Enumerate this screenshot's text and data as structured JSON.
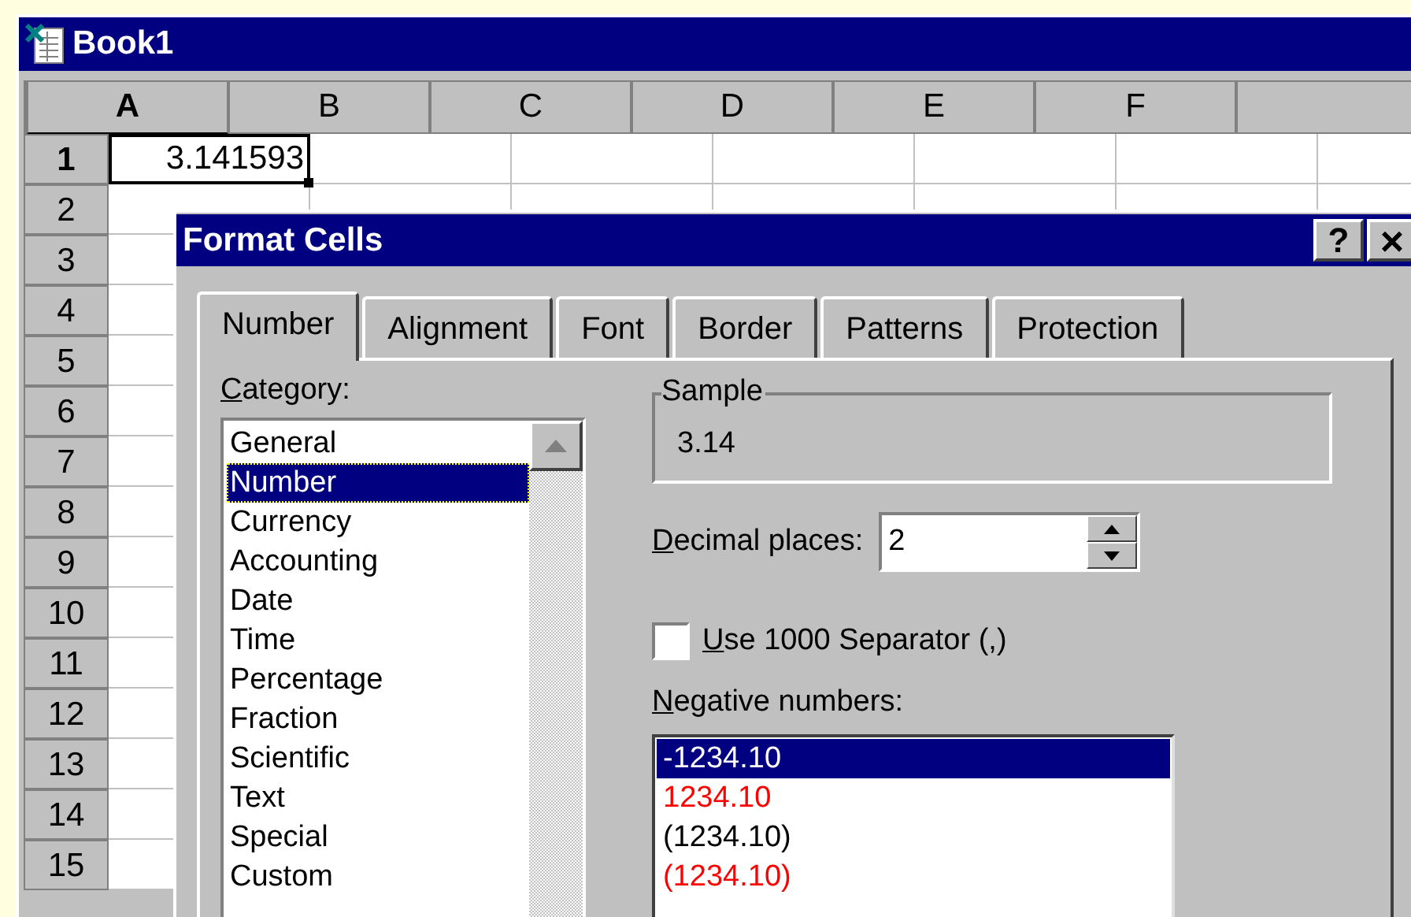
{
  "window": {
    "title": "Book1"
  },
  "sheet": {
    "columns": [
      {
        "label": "A",
        "selected": true
      },
      {
        "label": "B",
        "selected": false
      },
      {
        "label": "C",
        "selected": false
      },
      {
        "label": "D",
        "selected": false
      },
      {
        "label": "E",
        "selected": false
      },
      {
        "label": "F",
        "selected": false
      }
    ],
    "rows": [
      {
        "label": "1",
        "selected": true
      },
      {
        "label": "2",
        "selected": false
      },
      {
        "label": "3",
        "selected": false
      },
      {
        "label": "4",
        "selected": false
      },
      {
        "label": "5",
        "selected": false
      },
      {
        "label": "6",
        "selected": false
      },
      {
        "label": "7",
        "selected": false
      },
      {
        "label": "8",
        "selected": false
      },
      {
        "label": "9",
        "selected": false
      },
      {
        "label": "10",
        "selected": false
      },
      {
        "label": "11",
        "selected": false
      },
      {
        "label": "12",
        "selected": false
      },
      {
        "label": "13",
        "selected": false
      },
      {
        "label": "14",
        "selected": false
      },
      {
        "label": "15",
        "selected": false
      }
    ],
    "active_cell": {
      "value": "3.141593"
    }
  },
  "dialog": {
    "title": "Format Cells",
    "help_button": "?",
    "close_button": "×",
    "tabs": [
      {
        "label": "Number",
        "selected": true
      },
      {
        "label": "Alignment",
        "selected": false
      },
      {
        "label": "Font",
        "selected": false
      },
      {
        "label": "Border",
        "selected": false
      },
      {
        "label": "Patterns",
        "selected": false
      },
      {
        "label": "Protection",
        "selected": false
      }
    ],
    "category": {
      "label": "Category:",
      "items": [
        {
          "label": "General",
          "selected": false
        },
        {
          "label": "Number",
          "selected": true
        },
        {
          "label": "Currency",
          "selected": false
        },
        {
          "label": "Accounting",
          "selected": false
        },
        {
          "label": "Date",
          "selected": false
        },
        {
          "label": "Time",
          "selected": false
        },
        {
          "label": "Percentage",
          "selected": false
        },
        {
          "label": "Fraction",
          "selected": false
        },
        {
          "label": "Scientific",
          "selected": false
        },
        {
          "label": "Text",
          "selected": false
        },
        {
          "label": "Special",
          "selected": false
        },
        {
          "label": "Custom",
          "selected": false
        }
      ]
    },
    "sample": {
      "label": "Sample",
      "value": "3.14"
    },
    "decimal_places": {
      "label": "Decimal places:",
      "value": "2"
    },
    "separator": {
      "label": "Use 1000 Separator (,)",
      "checked": false
    },
    "negative_numbers": {
      "label": "Negative numbers:",
      "items": [
        {
          "label": "-1234.10",
          "color": "#ffffff",
          "selected": true
        },
        {
          "label": "1234.10",
          "color": "#ff0000",
          "selected": false
        },
        {
          "label": "(1234.10)",
          "color": "#000000",
          "selected": false
        },
        {
          "label": "(1234.10)",
          "color": "#ff0000",
          "selected": false
        }
      ]
    }
  }
}
